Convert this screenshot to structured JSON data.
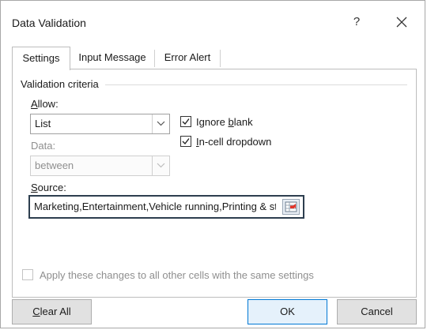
{
  "dialog": {
    "title": "Data Validation",
    "help_label": "?"
  },
  "tabs": [
    {
      "label": "Settings",
      "active": true
    },
    {
      "label": "Input Message",
      "active": false
    },
    {
      "label": "Error Alert",
      "active": false
    }
  ],
  "criteria": {
    "group_label": "Validation criteria",
    "allow": {
      "label_accel": "A",
      "label_rest": "llow:",
      "value": "List"
    },
    "ignore_blank": {
      "label_pre": "Ignore ",
      "label_accel": "b",
      "label_post": "lank",
      "checked": true
    },
    "in_cell_dropdown": {
      "label_accel": "I",
      "label_rest": "n-cell dropdown",
      "checked": true
    },
    "data": {
      "label": "Data:",
      "value": "between",
      "enabled": false
    },
    "source": {
      "label_accel": "S",
      "label_rest": "ource:",
      "value": "Marketing,Entertainment,Vehicle running,Printing & st"
    }
  },
  "apply_all": {
    "label": "Apply these changes to all other cells with the same settings",
    "checked": false,
    "enabled": false
  },
  "buttons": {
    "clear_all_accel": "C",
    "clear_all_rest": "lear All",
    "ok": "OK",
    "cancel": "Cancel"
  },
  "icons": {
    "close": "close-icon",
    "dropdown": "chevron-down-icon",
    "check": "checkmark-icon",
    "collapse": "collapse-dialog-icon"
  },
  "colors": {
    "accent": "#0078d4",
    "source_border": "#2d3e4f",
    "disabled_text": "#8f8f8f"
  }
}
